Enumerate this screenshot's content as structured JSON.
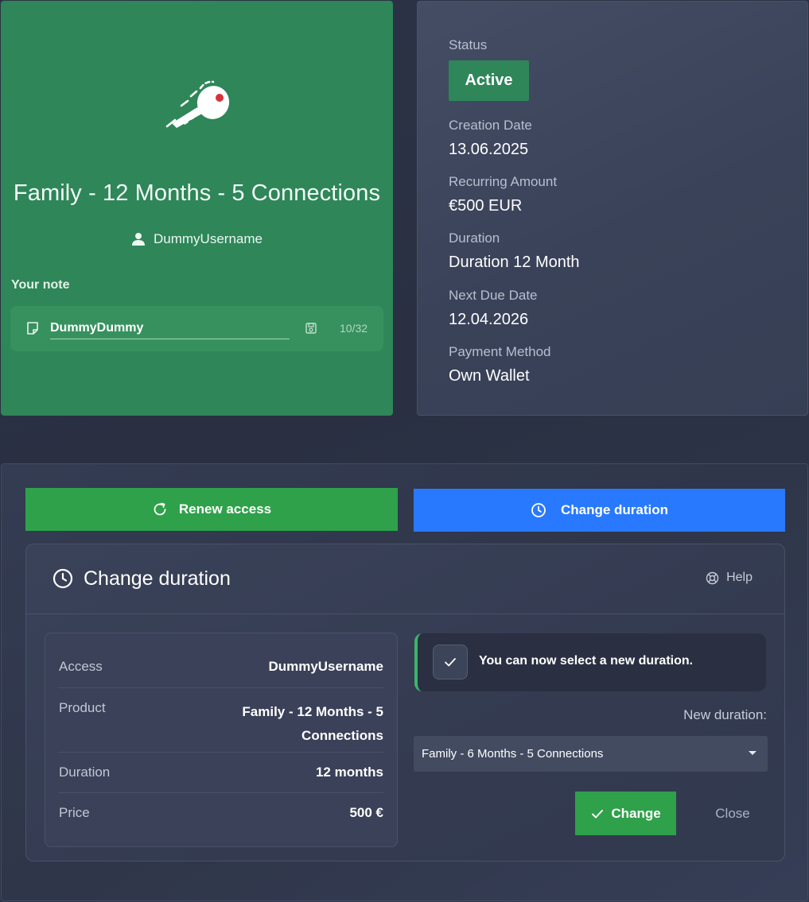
{
  "product": {
    "title": "Family - 12 Months - 5 Connections",
    "username": "DummyUsername",
    "note_label": "Your note",
    "note_value": "DummyDummy",
    "note_counter": "10/32",
    "card_color": "#2e8659"
  },
  "status": {
    "status_label": "Status",
    "status_value": "Active",
    "creation_date_label": "Creation Date",
    "creation_date": "13.06.2025",
    "recurring_amount_label": "Recurring Amount",
    "recurring_amount": "€500 EUR",
    "duration_label": "Duration",
    "duration": "Duration 12 Month",
    "next_due_date_label": "Next Due Date",
    "next_due_date": "12.04.2026",
    "payment_method_label": "Payment Method",
    "payment_method": "Own Wallet"
  },
  "actions": {
    "renew_label": "Renew access",
    "change_duration_label": "Change duration",
    "renew_color": "#2ea14a",
    "change_duration_color": "#2979ff"
  },
  "change_duration": {
    "title": "Change duration",
    "help_label": "Help",
    "info": [
      {
        "key": "Access",
        "value": "DummyUsername"
      },
      {
        "key": "Product",
        "value": "Family - 12 Months - 5 Connections"
      },
      {
        "key": "Duration",
        "value": "12 months"
      },
      {
        "key": "Price",
        "value": "500 €"
      }
    ],
    "notice": "You can now select a new duration.",
    "new_duration_label": "New duration:",
    "selected_duration": "Family - 6 Months - 5 Connections",
    "change_button": "Change",
    "close_button": "Close"
  }
}
